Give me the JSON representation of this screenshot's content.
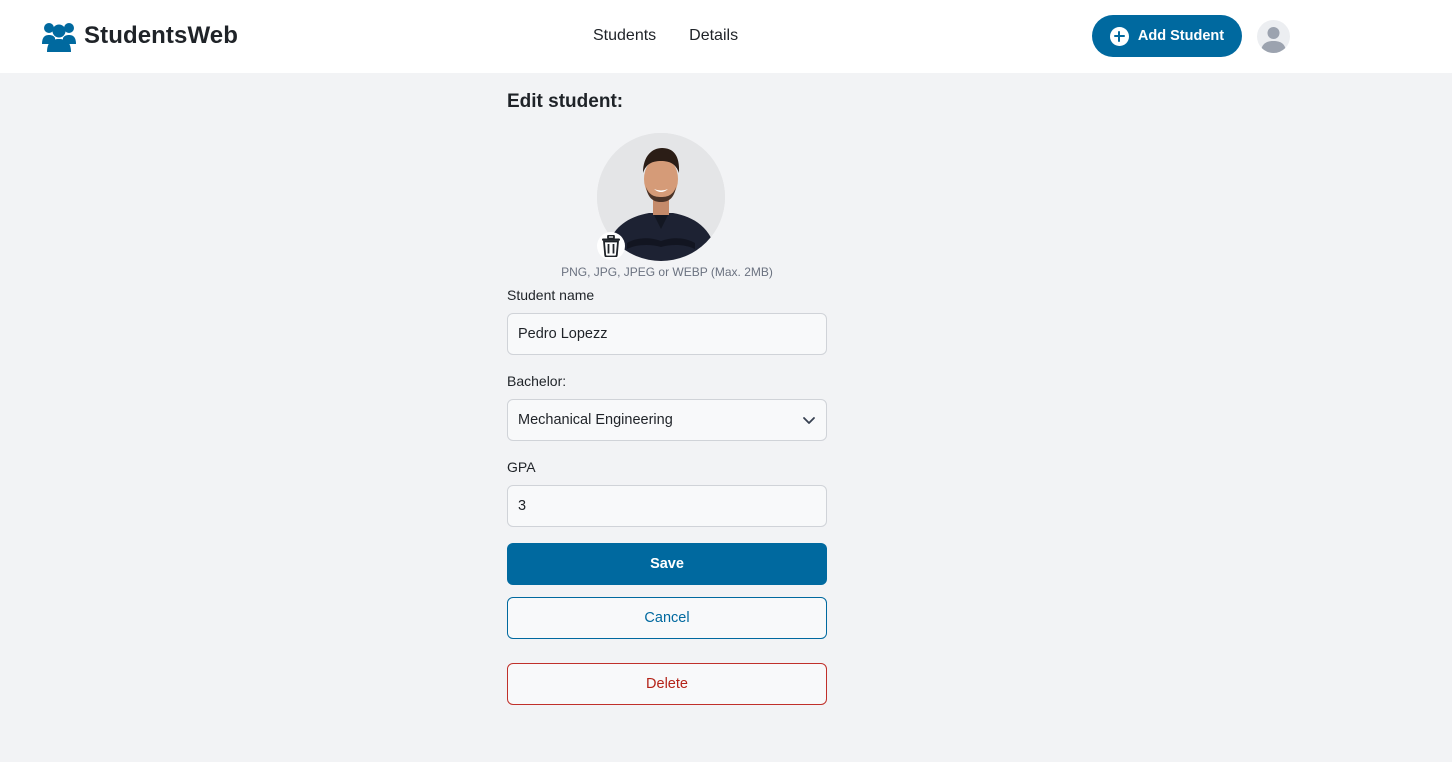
{
  "app": {
    "brand_name": "StudentsWeb",
    "brand_icon": "users-group-icon"
  },
  "nav": {
    "links": [
      "Students",
      "Details"
    ],
    "add_button_label": "Add Student",
    "add_button_icon": "plus-circle-icon",
    "avatar_icon": "user-avatar-icon"
  },
  "form": {
    "title": "Edit student:",
    "photo_hint": "PNG, JPG, JPEG or WEBP (Max. 2MB)",
    "delete_photo_icon": "trash-icon",
    "name_label": "Student name",
    "name_value": "Pedro Lopezz",
    "bachelor_label": "Bachelor:",
    "bachelor_value": "Mechanical Engineering",
    "gpa_label": "GPA",
    "gpa_value": "3",
    "save_label": "Save",
    "cancel_label": "Cancel",
    "delete_label": "Delete"
  },
  "colors": {
    "primary": "#00699f",
    "danger": "#b42318",
    "background": "#f2f3f5"
  }
}
